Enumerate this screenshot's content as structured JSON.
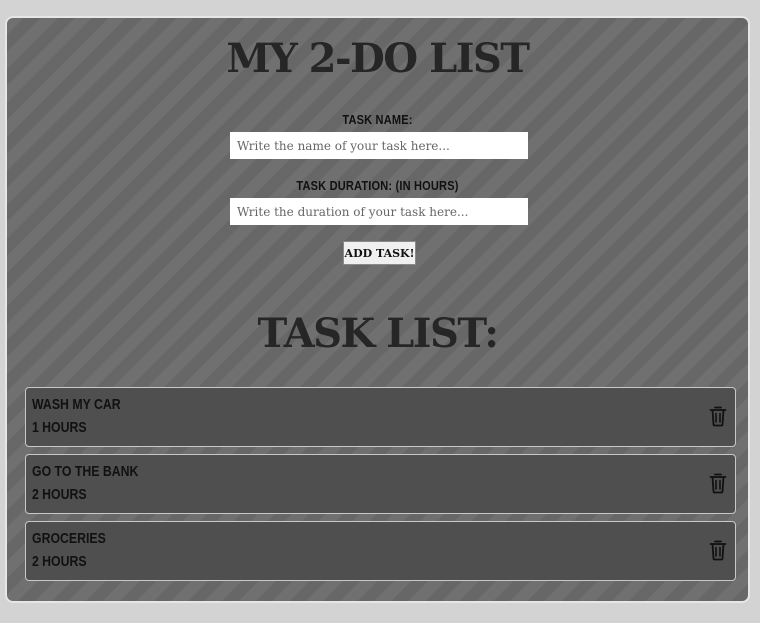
{
  "app": {
    "title": "My 2-Do List"
  },
  "form": {
    "name_label": "Task Name:",
    "name_placeholder": "Write the name of your task here...",
    "name_value": "",
    "duration_label": "Task Duration: (In Hours)",
    "duration_placeholder": "Write the duration of your task here...",
    "duration_value": "",
    "add_button_label": "Add Task!"
  },
  "task_list": {
    "title": "Task List:",
    "unit_label": "Hours",
    "delete_icon": "trash-icon",
    "items": [
      {
        "name": "Wash my car",
        "duration": "1"
      },
      {
        "name": "Go to the bank",
        "duration": "2"
      },
      {
        "name": "Groceries",
        "duration": "2"
      }
    ]
  },
  "colors": {
    "page_background": "#d3d3d3",
    "panel_background": "#6b6b6b",
    "task_background": "#4f4f4f",
    "text_dark": "#262626"
  }
}
